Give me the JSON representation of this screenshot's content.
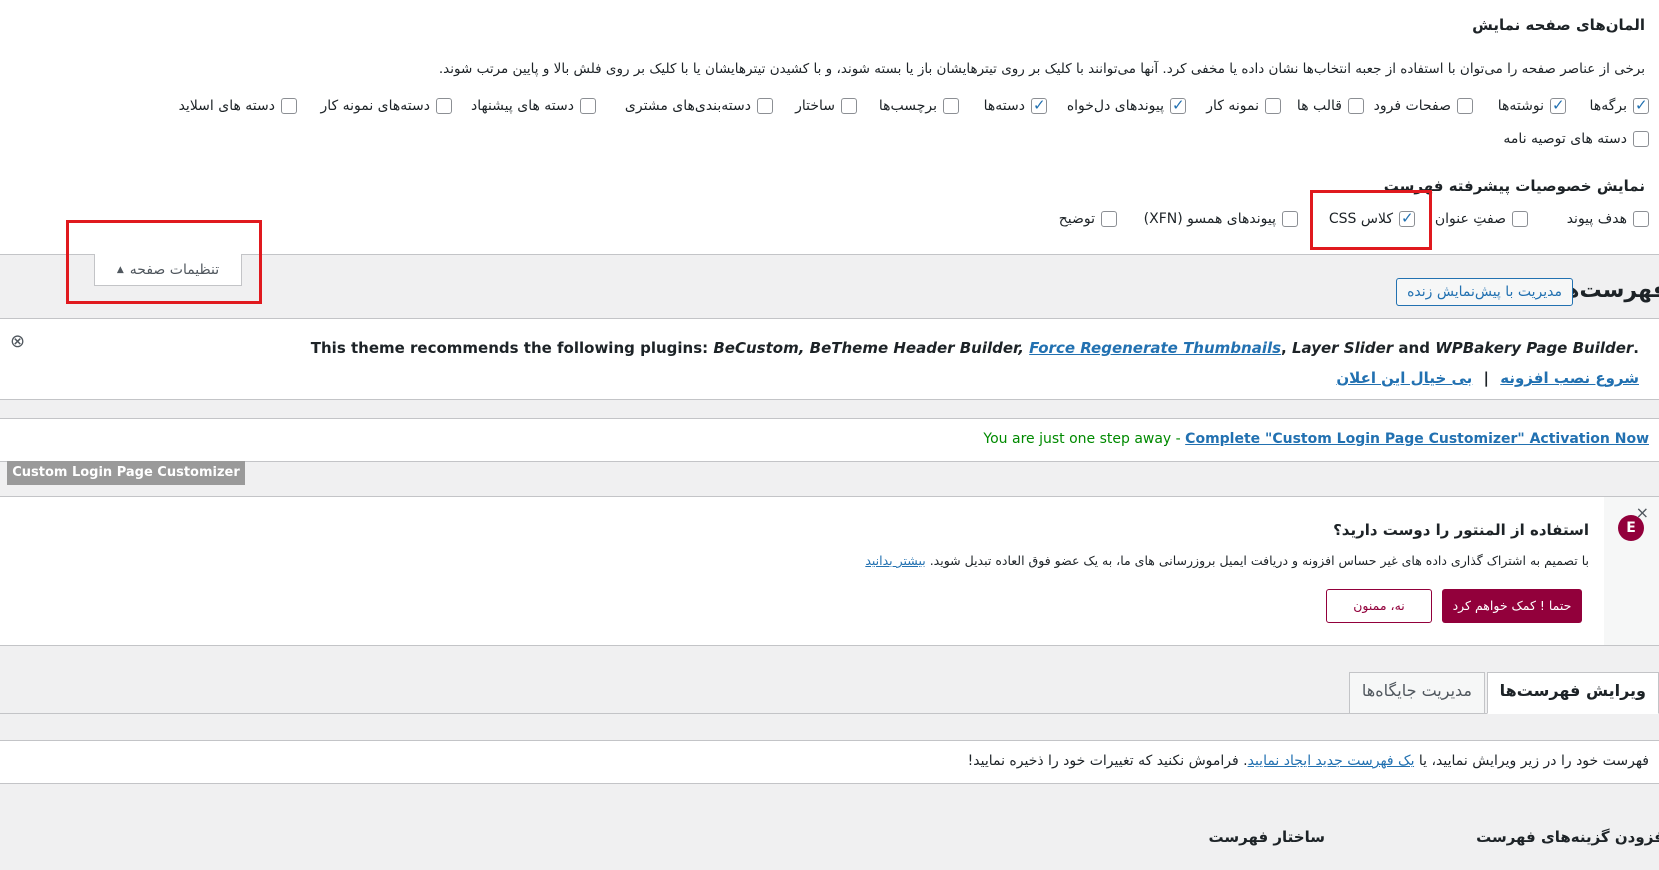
{
  "screen_options": {
    "title": "المان‌های صفحه نمایش",
    "description": "برخی از عناصر صفحه را می‌توان با استفاده از جعبه انتخاب‌ها نشان داده یا مخفی کرد. آنها می‌توانند با کلیک بر روی تیترهایشان باز یا بسته شوند، و با کشیدن تیترهایشان یا با کلیک بر روی فلش بالا و پایین مرتب شوند.",
    "boxes": [
      {
        "label": "برگه‌ها",
        "checked": true
      },
      {
        "label": "نوشته‌ها",
        "checked": true
      },
      {
        "label": "صفحات فرود",
        "checked": false
      },
      {
        "label": "قالب ها",
        "checked": false
      },
      {
        "label": "نمونه کار",
        "checked": false
      },
      {
        "label": "پیوندهای دل‌خواه",
        "checked": true
      },
      {
        "label": "دسته‌ها",
        "checked": true
      },
      {
        "label": "برچسب‌ها",
        "checked": false
      },
      {
        "label": "ساختار",
        "checked": false
      },
      {
        "label": "دسته‌بندی‌های مشتری",
        "checked": false
      },
      {
        "label": "دسته های پیشنهاد",
        "checked": false
      },
      {
        "label": "دسته‌های نمونه کار",
        "checked": false
      },
      {
        "label": "دسته های اسلاید",
        "checked": false
      },
      {
        "label": "دسته های توصیه نامه",
        "checked": false
      }
    ],
    "advanced_title": "نمایش خصوصیات پیشرفته فهرست",
    "advanced": [
      {
        "label": "هدف پیوند",
        "checked": false
      },
      {
        "label": "صفتِ عنوان",
        "checked": false
      },
      {
        "label": "کلاس CSS",
        "checked": true
      },
      {
        "label": "پیوندهای همسو (XFN)",
        "checked": false
      },
      {
        "label": "توضیح",
        "checked": false
      }
    ],
    "toggle_label": "تنظیمات صفحه",
    "toggle_arrow": "▲"
  },
  "header": {
    "page_title": "فهرست‌ها",
    "live_preview_button": "مدیریت با پیش‌نمایش زنده"
  },
  "theme_notice": {
    "prefix": "This theme recommends the following plugins:",
    "plugin1": "BeCustom,",
    "plugin2": "BeTheme Header Builder,",
    "plugin3_link": "Force Regenerate Thumbnails",
    "plugin4": "Layer Slider",
    "and_word": "and",
    "plugin5": "WPBakery Page Builder",
    "end_dot": ".",
    "begin_install": "شروع نصب افزونه",
    "separator": "|",
    "dismiss": "بی خیال این اعلان",
    "close_icon": "⊗"
  },
  "login_notice": {
    "text": "You are just one step away - ",
    "link": "Complete \"Custom Login Page Customizer\" Activation Now",
    "tag": "Custom Login Page Customizer"
  },
  "elementor": {
    "title": "استفاده از المنتور را دوست دارید؟",
    "description": "با تصمیم به اشتراک گذاری داده های غیر حساس افزونه و دریافت ایمیل بروزرسانی های ما، به یک عضو فوق العاده تبدیل شوید.",
    "learn_more": "بیشتر بدانید",
    "yes_button": "حتما ! کمک خواهم کرد",
    "no_button": "نه، ممنون",
    "close": "×",
    "logo_glyph": "E"
  },
  "tabs": {
    "edit_menus": "ویرایش فهرست‌ها",
    "manage_locations": "مدیریت جایگاه‌ها"
  },
  "edit_intro": {
    "before": "فهرست خود را در زیر ویرایش نمایید، یا ",
    "link": "یک فهرست جدید ایجاد نمایید",
    "after": ". فراموش نکنید که تغییرات خود را ذخیره نمایید!"
  },
  "columns": {
    "add_items": "افزودن گزینه‌های فهرست",
    "structure": "ساختار فهرست"
  },
  "colors": {
    "link": "#2271b1",
    "elementor": "#92003b",
    "highlight_box": "#e0191e",
    "login_green": "#008a00"
  }
}
